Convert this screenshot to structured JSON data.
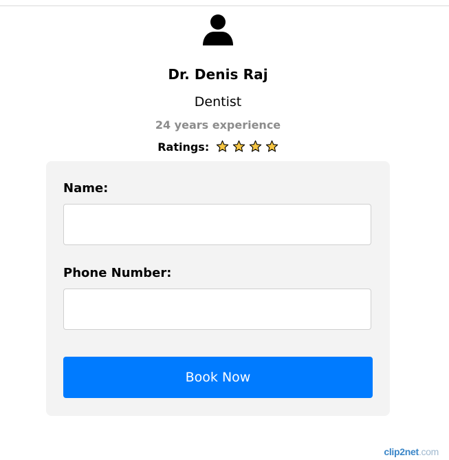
{
  "doctor": {
    "name": "Dr. Denis Raj",
    "specialty": "Dentist",
    "experience": "24 years experience",
    "ratings_label": "Ratings:",
    "rating_stars": 4,
    "avatar_icon": "user-icon",
    "star_icon": "star-icon",
    "star_color": "#f5c542"
  },
  "form": {
    "name_label": "Name:",
    "name_value": "",
    "phone_label": "Phone Number:",
    "phone_value": "",
    "submit_label": "Book Now",
    "submit_color": "#007bff"
  },
  "watermark": {
    "brand": "clip2net",
    "tld": ".com"
  }
}
